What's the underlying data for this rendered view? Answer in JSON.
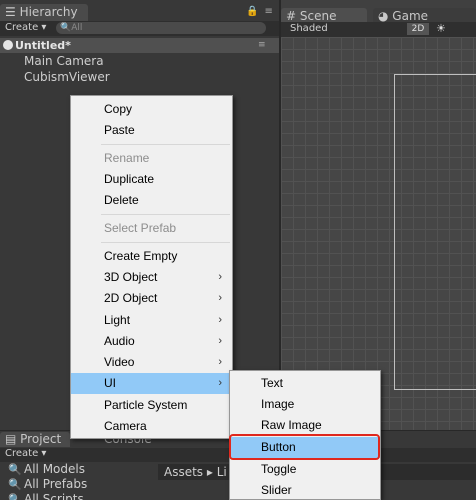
{
  "hierarchy": {
    "tab_label": "Hierarchy",
    "create_label": "Create ▾",
    "search_placeholder": "All",
    "scene_name": "Untitled*",
    "items": [
      "Main Camera",
      "CubismViewer"
    ]
  },
  "scene": {
    "tab_label": "Scene",
    "shading": "Shaded",
    "mode_2d": "2D"
  },
  "game": {
    "tab_label": "Game"
  },
  "project": {
    "tab_label": "Project",
    "console_label": "Console",
    "create_label": "Create ▾",
    "favorites": [
      "All Models",
      "All Prefabs",
      "All Scripts"
    ],
    "path": "Assets ▸ Li"
  },
  "context_menu": {
    "items": [
      {
        "label": "Copy",
        "disabled": false,
        "submenu": false
      },
      {
        "label": "Paste",
        "disabled": false,
        "submenu": false
      },
      {
        "label": "Rename",
        "disabled": true,
        "submenu": false
      },
      {
        "label": "Duplicate",
        "disabled": false,
        "submenu": false
      },
      {
        "label": "Delete",
        "disabled": false,
        "submenu": false
      },
      {
        "label": "Select Prefab",
        "disabled": true,
        "submenu": false
      },
      {
        "label": "Create Empty",
        "disabled": false,
        "submenu": false
      },
      {
        "label": "3D Object",
        "disabled": false,
        "submenu": true
      },
      {
        "label": "2D Object",
        "disabled": false,
        "submenu": true
      },
      {
        "label": "Light",
        "disabled": false,
        "submenu": true
      },
      {
        "label": "Audio",
        "disabled": false,
        "submenu": true
      },
      {
        "label": "Video",
        "disabled": false,
        "submenu": true
      },
      {
        "label": "UI",
        "disabled": false,
        "submenu": true,
        "highlighted": true
      },
      {
        "label": "Particle System",
        "disabled": false,
        "submenu": false
      },
      {
        "label": "Camera",
        "disabled": false,
        "submenu": false
      }
    ]
  },
  "ui_submenu": {
    "items": [
      "Text",
      "Image",
      "Raw Image",
      "Button",
      "Toggle",
      "Slider"
    ],
    "highlighted": "Button"
  },
  "colors": {
    "menu_highlight": "#91c9f7",
    "outline_red": "#e0281e"
  }
}
